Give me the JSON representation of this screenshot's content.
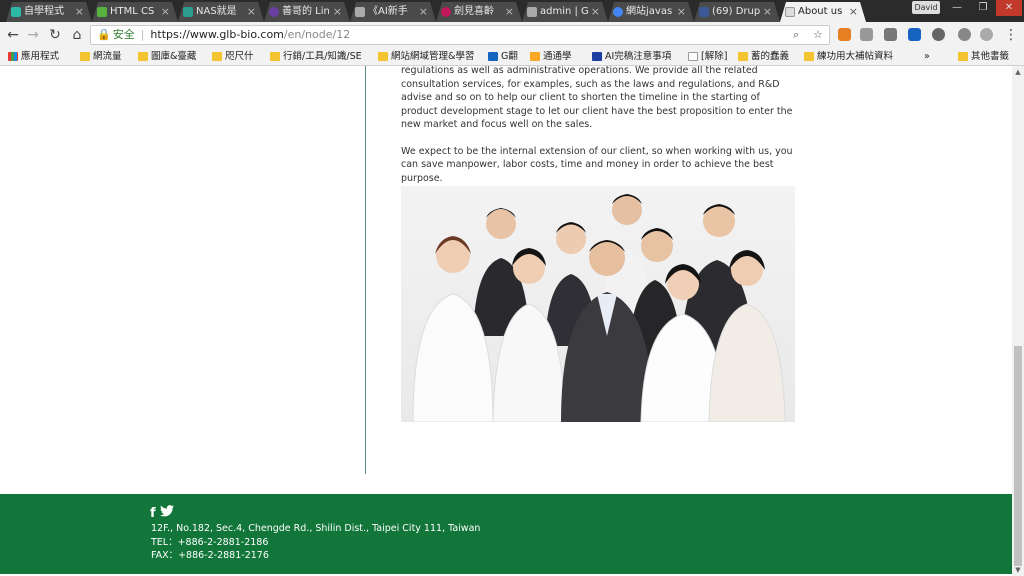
{
  "tabs": [
    {
      "label": "自學程式",
      "fav_color": "#2bb8a6"
    },
    {
      "label": "HTML CS",
      "fav_color": "#55b33d"
    },
    {
      "label": "NAS就是",
      "fav_color": "#2b9c8e"
    },
    {
      "label": "善哥的 Lin",
      "fav_color": "#6b3fa0"
    },
    {
      "label": "《AI新手",
      "fav_color": "#aaaaaa"
    },
    {
      "label": "劍見喜齡",
      "fav_color": "#c2185b"
    },
    {
      "label": "admin | G",
      "fav_color": "#aaaaaa"
    },
    {
      "label": "網站javas",
      "fav_color": "#4285f4"
    },
    {
      "label": "(69) Drup",
      "fav_color": "#3b5998"
    },
    {
      "label": "About us",
      "fav_color": "#dddddd"
    }
  ],
  "window": {
    "user": "David",
    "minimize": "—",
    "maximize": "❐",
    "close": "✕"
  },
  "toolbar": {
    "back": "←",
    "forward": "→",
    "reload": "↻",
    "home": "⌂",
    "secure_label": "安全",
    "url_host": "https://www.glb-bio.com",
    "url_path": "/en/node/12",
    "search_glyph": "⌕",
    "star_glyph": "☆",
    "menu_glyph": "⋮"
  },
  "bookmarks": [
    {
      "label": "應用程式"
    },
    {
      "label": "網流量"
    },
    {
      "label": "圖庫&臺藏"
    },
    {
      "label": "咫尺什"
    },
    {
      "label": "行銷/工具/知識/SE"
    },
    {
      "label": "網站網域管理&學習"
    },
    {
      "label": "G翻"
    },
    {
      "label": "通通學"
    },
    {
      "label": "AI完稿注意事項"
    },
    {
      "label": "[解除]"
    },
    {
      "label": "蓄的蠢義"
    },
    {
      "label": "練功用大補帖資料"
    },
    {
      "label": "»"
    },
    {
      "label": "其他書籤"
    }
  ],
  "content": {
    "p1": "regulations as well as administrative operations. We provide all the related consultation services, for examples, such as the laws and regulations, and R&D advise and so on to help our client to shorten the timeline in the starting of product development stage to let our client have the best proposition to enter the new market and focus well on the sales.",
    "p2": "We expect to be the internal extension of our client, so when working with us, you can save manpower, labor costs, time and money in order to achieve the best purpose."
  },
  "footer": {
    "facebook": "f",
    "twitter": "🐦",
    "address": "12F., No.182, Sec.4, Chengde Rd., Shilin Dist., Taipei City 111, Taiwan",
    "tel": "TEL：+886-2-2881-2186",
    "fax": "FAX：+886-2-2881-2176"
  },
  "colors": {
    "footer_bg": "#12763a",
    "accent_green": "#2e7d32"
  }
}
